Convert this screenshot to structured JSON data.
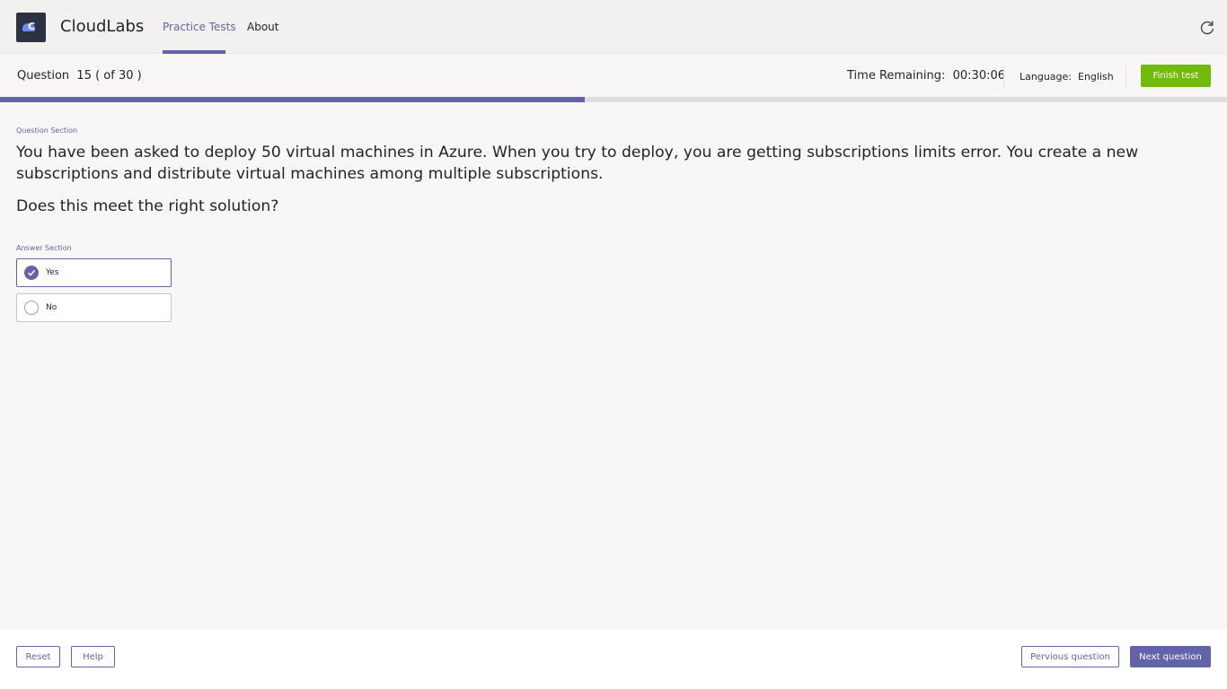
{
  "app": {
    "logo_letter": "C",
    "title": "CloudLabs",
    "accent_color": "#6264a7",
    "success_color": "#73ba0e"
  },
  "nav": {
    "tabs": [
      {
        "label": "Practice Tests",
        "active": true
      },
      {
        "label": "About",
        "active": false
      }
    ],
    "refresh_icon": "refresh-icon"
  },
  "question_bar": {
    "label": "Question",
    "counter": "15 ( of 30 )",
    "time_label": "Time Remaining:",
    "time_value": "00:30:06",
    "language_label": "Language:",
    "language_value": "English",
    "finish_label": "Finish test"
  },
  "progress": {
    "current": 15,
    "total": 30,
    "fraction": 0.4766
  },
  "content": {
    "question_section_label": "Question Section",
    "question_text": "You have been asked to deploy 50 virtual machines in Azure. When you try to deploy, you are getting subscriptions limits error. You create a new subscriptions and distribute virtual machines among multiple subscriptions.",
    "question_prompt": "Does this meet the right solution?",
    "answer_section_label": "Answer Section",
    "options": [
      {
        "label": "Yes",
        "selected": true
      },
      {
        "label": "No",
        "selected": false
      }
    ]
  },
  "footer": {
    "reset_label": "Reset",
    "help_label": "Help",
    "prev_label": "Pervious question",
    "next_label": "Next question"
  }
}
